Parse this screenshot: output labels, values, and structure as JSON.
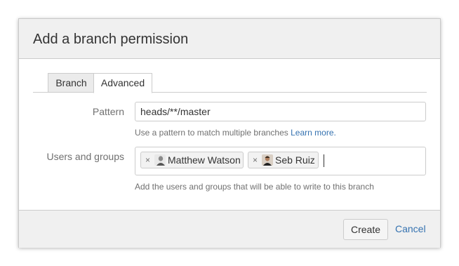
{
  "dialog": {
    "title": "Add a branch permission",
    "tabs": [
      {
        "label": "Branch",
        "active": false
      },
      {
        "label": "Advanced",
        "active": true
      }
    ]
  },
  "pattern": {
    "label": "Pattern",
    "value": "heads/**/master",
    "help_text": "Use a pattern to match multiple branches",
    "help_link": "Learn more."
  },
  "users": {
    "label": "Users and groups",
    "selected": [
      {
        "name": "Matthew Watson",
        "remove": "×"
      },
      {
        "name": "Seb Ruiz",
        "remove": "×"
      }
    ],
    "help_text": "Add the users and groups that will be able to write to this branch"
  },
  "footer": {
    "create_label": "Create",
    "cancel_label": "Cancel"
  },
  "colors": {
    "link": "#3572b0",
    "header_bg": "#f0f0f0",
    "border": "#cccccc"
  }
}
